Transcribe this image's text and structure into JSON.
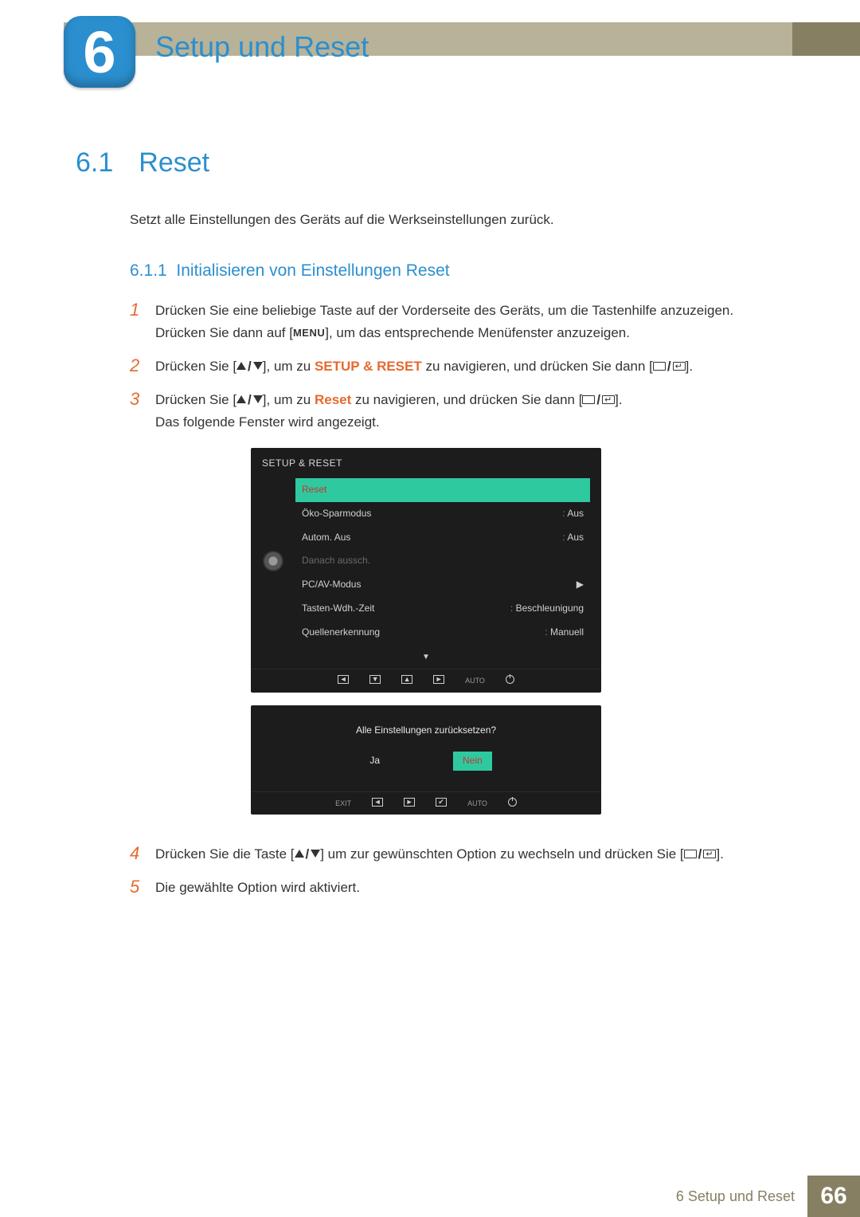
{
  "chapter": {
    "number": "6",
    "title": "Setup und Reset"
  },
  "section": {
    "number": "6.1",
    "title": "Reset"
  },
  "intro": "Setzt alle Einstellungen des Geräts auf die Werkseinstellungen zurück.",
  "subsection": {
    "number": "6.1.1",
    "title": "Initialisieren von Einstellungen Reset"
  },
  "steps": {
    "s1a": "Drücken Sie eine beliebige Taste auf der Vorderseite des Geräts, um die Tastenhilfe anzuzeigen.",
    "s1b_pre": "Drücken Sie dann auf [",
    "s1b_menu": "MENU",
    "s1b_post": "], um das entsprechende Menüfenster anzuzeigen.",
    "s2_pre": "Drücken Sie [",
    "s2_mid": "], um zu ",
    "s2_target": "SETUP & RESET",
    "s2_post": " zu navigieren, und drücken Sie dann [",
    "s2_end": "].",
    "s3_pre": "Drücken Sie [",
    "s3_mid": "], um zu ",
    "s3_target": "Reset",
    "s3_post": " zu navigieren, und drücken Sie dann [",
    "s3_end": "].",
    "s3_extra": "Das folgende Fenster wird angezeigt.",
    "s4_pre": "Drücken Sie die Taste [",
    "s4_mid": "] um zur gewünschten Option zu wechseln und drücken Sie [",
    "s4_end": "].",
    "s5": "Die gewählte Option wird aktiviert."
  },
  "osd": {
    "title": "SETUP & RESET",
    "rows": [
      {
        "label": "Reset",
        "value": "",
        "sel": true
      },
      {
        "label": "Öko-Sparmodus",
        "value": "Aus"
      },
      {
        "label": "Autom. Aus",
        "value": "Aus"
      },
      {
        "label": "Danach aussch.",
        "value": "",
        "dim": true
      },
      {
        "label": "PC/AV-Modus",
        "value": "",
        "arrow": true
      },
      {
        "label": "Tasten-Wdh.-Zeit",
        "value": "Beschleunigung"
      },
      {
        "label": "Quellenerkennung",
        "value": "Manuell"
      }
    ],
    "footer_auto": "AUTO"
  },
  "confirm": {
    "question": "Alle Einstellungen zurücksetzen?",
    "yes": "Ja",
    "no": "Nein",
    "exit": "EXIT",
    "auto": "AUTO"
  },
  "footer": {
    "text": "6 Setup und Reset",
    "page": "66"
  }
}
